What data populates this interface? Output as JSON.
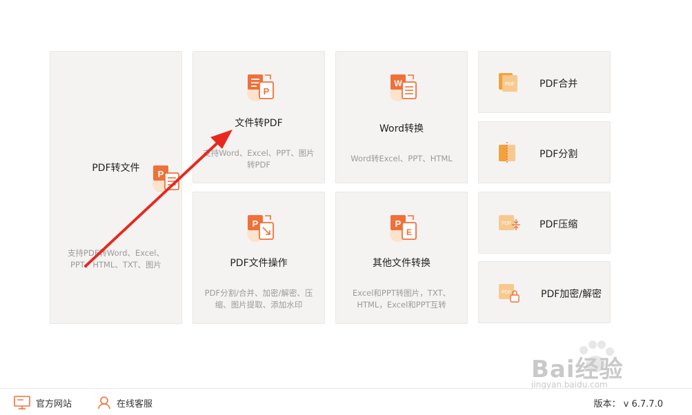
{
  "cards": {
    "pdf_to_file": {
      "title": "PDF转文件",
      "desc": "支持PDF转Word、Excel、PPT、HTML、TXT、图片"
    },
    "file_to_pdf": {
      "title": "文件转PDF",
      "desc": "支持Word、Excel、PPT、图片转PDF"
    },
    "word_convert": {
      "title": "Word转换",
      "desc": "Word转Excel、PPT、HTML"
    },
    "pdf_ops": {
      "title": "PDF文件操作",
      "desc": "PDF分割/合并、加密/解密、压缩、图片提取、添加水印"
    },
    "other_convert": {
      "title": "其他文件转换",
      "desc": "Excel和PPT转图片，TXT、HTML，Excel和PPT互转"
    },
    "pdf_merge": {
      "title": "PDF合并"
    },
    "pdf_split": {
      "title": "PDF分割"
    },
    "pdf_compress": {
      "title": "PDF压缩"
    },
    "pdf_encrypt": {
      "title": "PDF加密/解密"
    }
  },
  "icons": {
    "p": "P",
    "w": "W",
    "pdf": "PDF"
  },
  "footer": {
    "website": "官方网站",
    "service": "在线客服",
    "version": "版本： v 6.7.7.0"
  },
  "watermark": {
    "text": "Bai经验",
    "sub": "jingyan.baidu.com"
  },
  "colors": {
    "orange": "#f0703a",
    "light_orange": "#f8c98f",
    "arrow": "#e8281e"
  }
}
